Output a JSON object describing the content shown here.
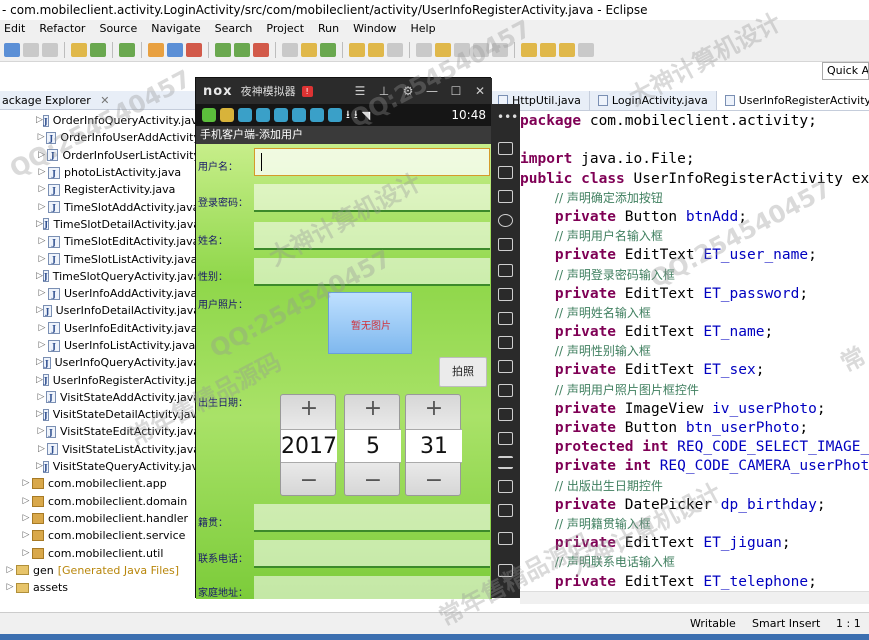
{
  "window": {
    "title": "- com.mobileclient.activity.LoginActivity/src/com/mobileclient/activity/UserInfoRegisterActivity.java - Eclipse"
  },
  "menu": [
    "Edit",
    "Refactor",
    "Source",
    "Navigate",
    "Search",
    "Project",
    "Run",
    "Window",
    "Help"
  ],
  "quick_access": "Quick Ac",
  "package_explorer": {
    "tab_label": "ackage Explorer",
    "items": [
      {
        "label": "OrderInfoQueryActivity.java",
        "kind": "file"
      },
      {
        "label": "OrderInfoUserAddActivity",
        "kind": "file"
      },
      {
        "label": "OrderInfoUserListActivity",
        "kind": "file"
      },
      {
        "label": "photoListActivity.java",
        "kind": "file"
      },
      {
        "label": "RegisterActivity.java",
        "kind": "file"
      },
      {
        "label": "TimeSlotAddActivity.java",
        "kind": "file"
      },
      {
        "label": "TimeSlotDetailActivity.java",
        "kind": "file"
      },
      {
        "label": "TimeSlotEditActivity.java",
        "kind": "file"
      },
      {
        "label": "TimeSlotListActivity.java",
        "kind": "file"
      },
      {
        "label": "TimeSlotQueryActivity.java",
        "kind": "file"
      },
      {
        "label": "UserInfoAddActivity.java",
        "kind": "file"
      },
      {
        "label": "UserInfoDetailActivity.java",
        "kind": "file"
      },
      {
        "label": "UserInfoEditActivity.java",
        "kind": "file"
      },
      {
        "label": "UserInfoListActivity.java",
        "kind": "file"
      },
      {
        "label": "UserInfoQueryActivity.java",
        "kind": "file"
      },
      {
        "label": "UserInfoRegisterActivity.java",
        "kind": "file"
      },
      {
        "label": "VisitStateAddActivity.java",
        "kind": "file"
      },
      {
        "label": "VisitStateDetailActivity.java",
        "kind": "file"
      },
      {
        "label": "VisitStateEditActivity.java",
        "kind": "file"
      },
      {
        "label": "VisitStateListActivity.java",
        "kind": "file"
      },
      {
        "label": "VisitStateQueryActivity.java",
        "kind": "file"
      },
      {
        "label": "com.mobileclient.app",
        "kind": "package"
      },
      {
        "label": "com.mobileclient.domain",
        "kind": "package"
      },
      {
        "label": "com.mobileclient.handler",
        "kind": "package"
      },
      {
        "label": "com.mobileclient.service",
        "kind": "package"
      },
      {
        "label": "com.mobileclient.util",
        "kind": "package"
      },
      {
        "label": "gen",
        "suffix": "[Generated Java Files]",
        "kind": "folder"
      },
      {
        "label": "assets",
        "kind": "folder"
      }
    ]
  },
  "editor": {
    "tabs": [
      {
        "label": "HttpUtil.java",
        "active": false
      },
      {
        "label": "LoginActivity.java",
        "active": false
      },
      {
        "label": "UserInfoRegisterActivity.java",
        "active": true
      }
    ],
    "lines": [
      [
        [
          "kw",
          "package"
        ],
        [
          "t",
          " com.mobileclient.activity;"
        ]
      ],
      [
        [
          "t",
          ""
        ]
      ],
      [
        [
          "kw",
          "import"
        ],
        [
          "t",
          " java.io.File;"
        ]
      ],
      [
        [
          "kw",
          "public"
        ],
        [
          "t",
          " "
        ],
        [
          "kw",
          "class"
        ],
        [
          "t",
          " UserInfoRegisterActivity ex"
        ]
      ],
      [
        [
          "t",
          "    "
        ],
        [
          "cm",
          "// 声明确定添加按钮"
        ]
      ],
      [
        [
          "t",
          "    "
        ],
        [
          "kw",
          "private"
        ],
        [
          "t",
          " Button "
        ],
        [
          "fld",
          "btnAdd"
        ],
        [
          "t",
          ";"
        ]
      ],
      [
        [
          "t",
          "    "
        ],
        [
          "cm",
          "// 声明用户名输入框"
        ]
      ],
      [
        [
          "t",
          "    "
        ],
        [
          "kw",
          "private"
        ],
        [
          "t",
          " EditText "
        ],
        [
          "fld",
          "ET_user_name"
        ],
        [
          "t",
          ";"
        ]
      ],
      [
        [
          "t",
          "    "
        ],
        [
          "cm",
          "// 声明登录密码输入框"
        ]
      ],
      [
        [
          "t",
          "    "
        ],
        [
          "kw",
          "private"
        ],
        [
          "t",
          " EditText "
        ],
        [
          "fld",
          "ET_password"
        ],
        [
          "t",
          ";"
        ]
      ],
      [
        [
          "t",
          "    "
        ],
        [
          "cm",
          "// 声明姓名输入框"
        ]
      ],
      [
        [
          "t",
          "    "
        ],
        [
          "kw",
          "private"
        ],
        [
          "t",
          " EditText "
        ],
        [
          "fld",
          "ET_name"
        ],
        [
          "t",
          ";"
        ]
      ],
      [
        [
          "t",
          "    "
        ],
        [
          "cm",
          "// 声明性别输入框"
        ]
      ],
      [
        [
          "t",
          "    "
        ],
        [
          "kw",
          "private"
        ],
        [
          "t",
          " EditText "
        ],
        [
          "fld",
          "ET_sex"
        ],
        [
          "t",
          ";"
        ]
      ],
      [
        [
          "t",
          "    "
        ],
        [
          "cm",
          "// 声明用户照片图片框控件"
        ]
      ],
      [
        [
          "t",
          "    "
        ],
        [
          "kw",
          "private"
        ],
        [
          "t",
          " ImageView "
        ],
        [
          "fld",
          "iv_userPhoto"
        ],
        [
          "t",
          ";"
        ]
      ],
      [
        [
          "t",
          "    "
        ],
        [
          "kw",
          "private"
        ],
        [
          "t",
          " Button "
        ],
        [
          "fld",
          "btn_userPhoto"
        ],
        [
          "t",
          ";"
        ]
      ],
      [
        [
          "t",
          "    "
        ],
        [
          "kw",
          "protected"
        ],
        [
          "t",
          " "
        ],
        [
          "kw",
          "int"
        ],
        [
          "t",
          " "
        ],
        [
          "fld",
          "REQ_CODE_SELECT_IMAGE_"
        ]
      ],
      [
        [
          "t",
          "    "
        ],
        [
          "kw",
          "private"
        ],
        [
          "t",
          " "
        ],
        [
          "kw",
          "int"
        ],
        [
          "t",
          " "
        ],
        [
          "fld",
          "REQ_CODE_CAMERA_userPhot"
        ]
      ],
      [
        [
          "t",
          "    "
        ],
        [
          "cm",
          "// 出版出生日期控件"
        ]
      ],
      [
        [
          "t",
          "    "
        ],
        [
          "kw",
          "private"
        ],
        [
          "t",
          " DatePicker "
        ],
        [
          "fld",
          "dp_birthday"
        ],
        [
          "t",
          ";"
        ]
      ],
      [
        [
          "t",
          "    "
        ],
        [
          "cm",
          "// 声明籍贯输入框"
        ]
      ],
      [
        [
          "t",
          "    "
        ],
        [
          "kw",
          "private"
        ],
        [
          "t",
          " EditText "
        ],
        [
          "fld",
          "ET_jiguan"
        ],
        [
          "t",
          ";"
        ]
      ],
      [
        [
          "t",
          "    "
        ],
        [
          "cm",
          "// 声明联系电话输入框"
        ]
      ],
      [
        [
          "t",
          "    "
        ],
        [
          "kw",
          "private"
        ],
        [
          "t",
          " EditText "
        ],
        [
          "fld",
          "ET_telephone"
        ],
        [
          "t",
          ";"
        ]
      ]
    ]
  },
  "status": {
    "writable": "Writable",
    "insert_mode": "Smart Insert",
    "position": "1 : 1"
  },
  "nox": {
    "logo": "nox",
    "name": "夜神模拟器",
    "clock": "10:48",
    "app_title": "手机客户端-添加用户",
    "labels": {
      "username": "用户名：",
      "password": "登录密码：",
      "name": "姓名：",
      "sex": "性别：",
      "photo": "用户照片：",
      "birthday": "出生日期：",
      "jiguan": "籍贯：",
      "telephone": "联系电话：",
      "address": "家庭地址："
    },
    "no_image_text": "暂无图片",
    "photo_button": "拍照",
    "date": {
      "year": "2017",
      "month": "5",
      "day": "31"
    },
    "plus": "+",
    "minus": "−"
  },
  "watermarks": [
    "QQ:254540457",
    "大神计算机设计",
    "常年售精品源码",
    "QQ:254540457",
    "大神计算机设计",
    "QQ:254540457",
    "常年售精品源码",
    "QQ:254540457",
    "大神计算机设计",
    "常"
  ]
}
